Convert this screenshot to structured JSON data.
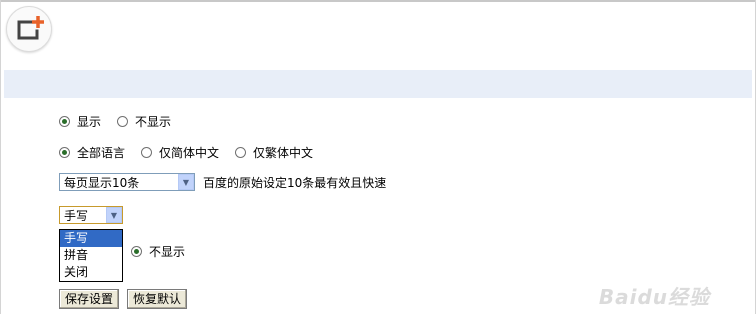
{
  "display_options": {
    "show_label": "显示",
    "hide_label": "不显示"
  },
  "language_options": {
    "all_label": "全部语言",
    "simplified_label": "仅简体中文",
    "traditional_label": "仅繁体中文"
  },
  "results_per_page": {
    "selected": "每页显示10条",
    "hint": "百度的原始设定10条最有效且快速"
  },
  "input_method": {
    "selected": "手写",
    "options": [
      "手写",
      "拼音",
      "关闭"
    ],
    "row_hide_label": "不显示"
  },
  "buttons": {
    "save_label": "保存设置",
    "reset_label": "恢复默认"
  },
  "watermark": "Baidu经验",
  "colors": {
    "band": "#e8eef8",
    "selected_option": "#316ac5",
    "logo_orange": "#e8622a"
  }
}
